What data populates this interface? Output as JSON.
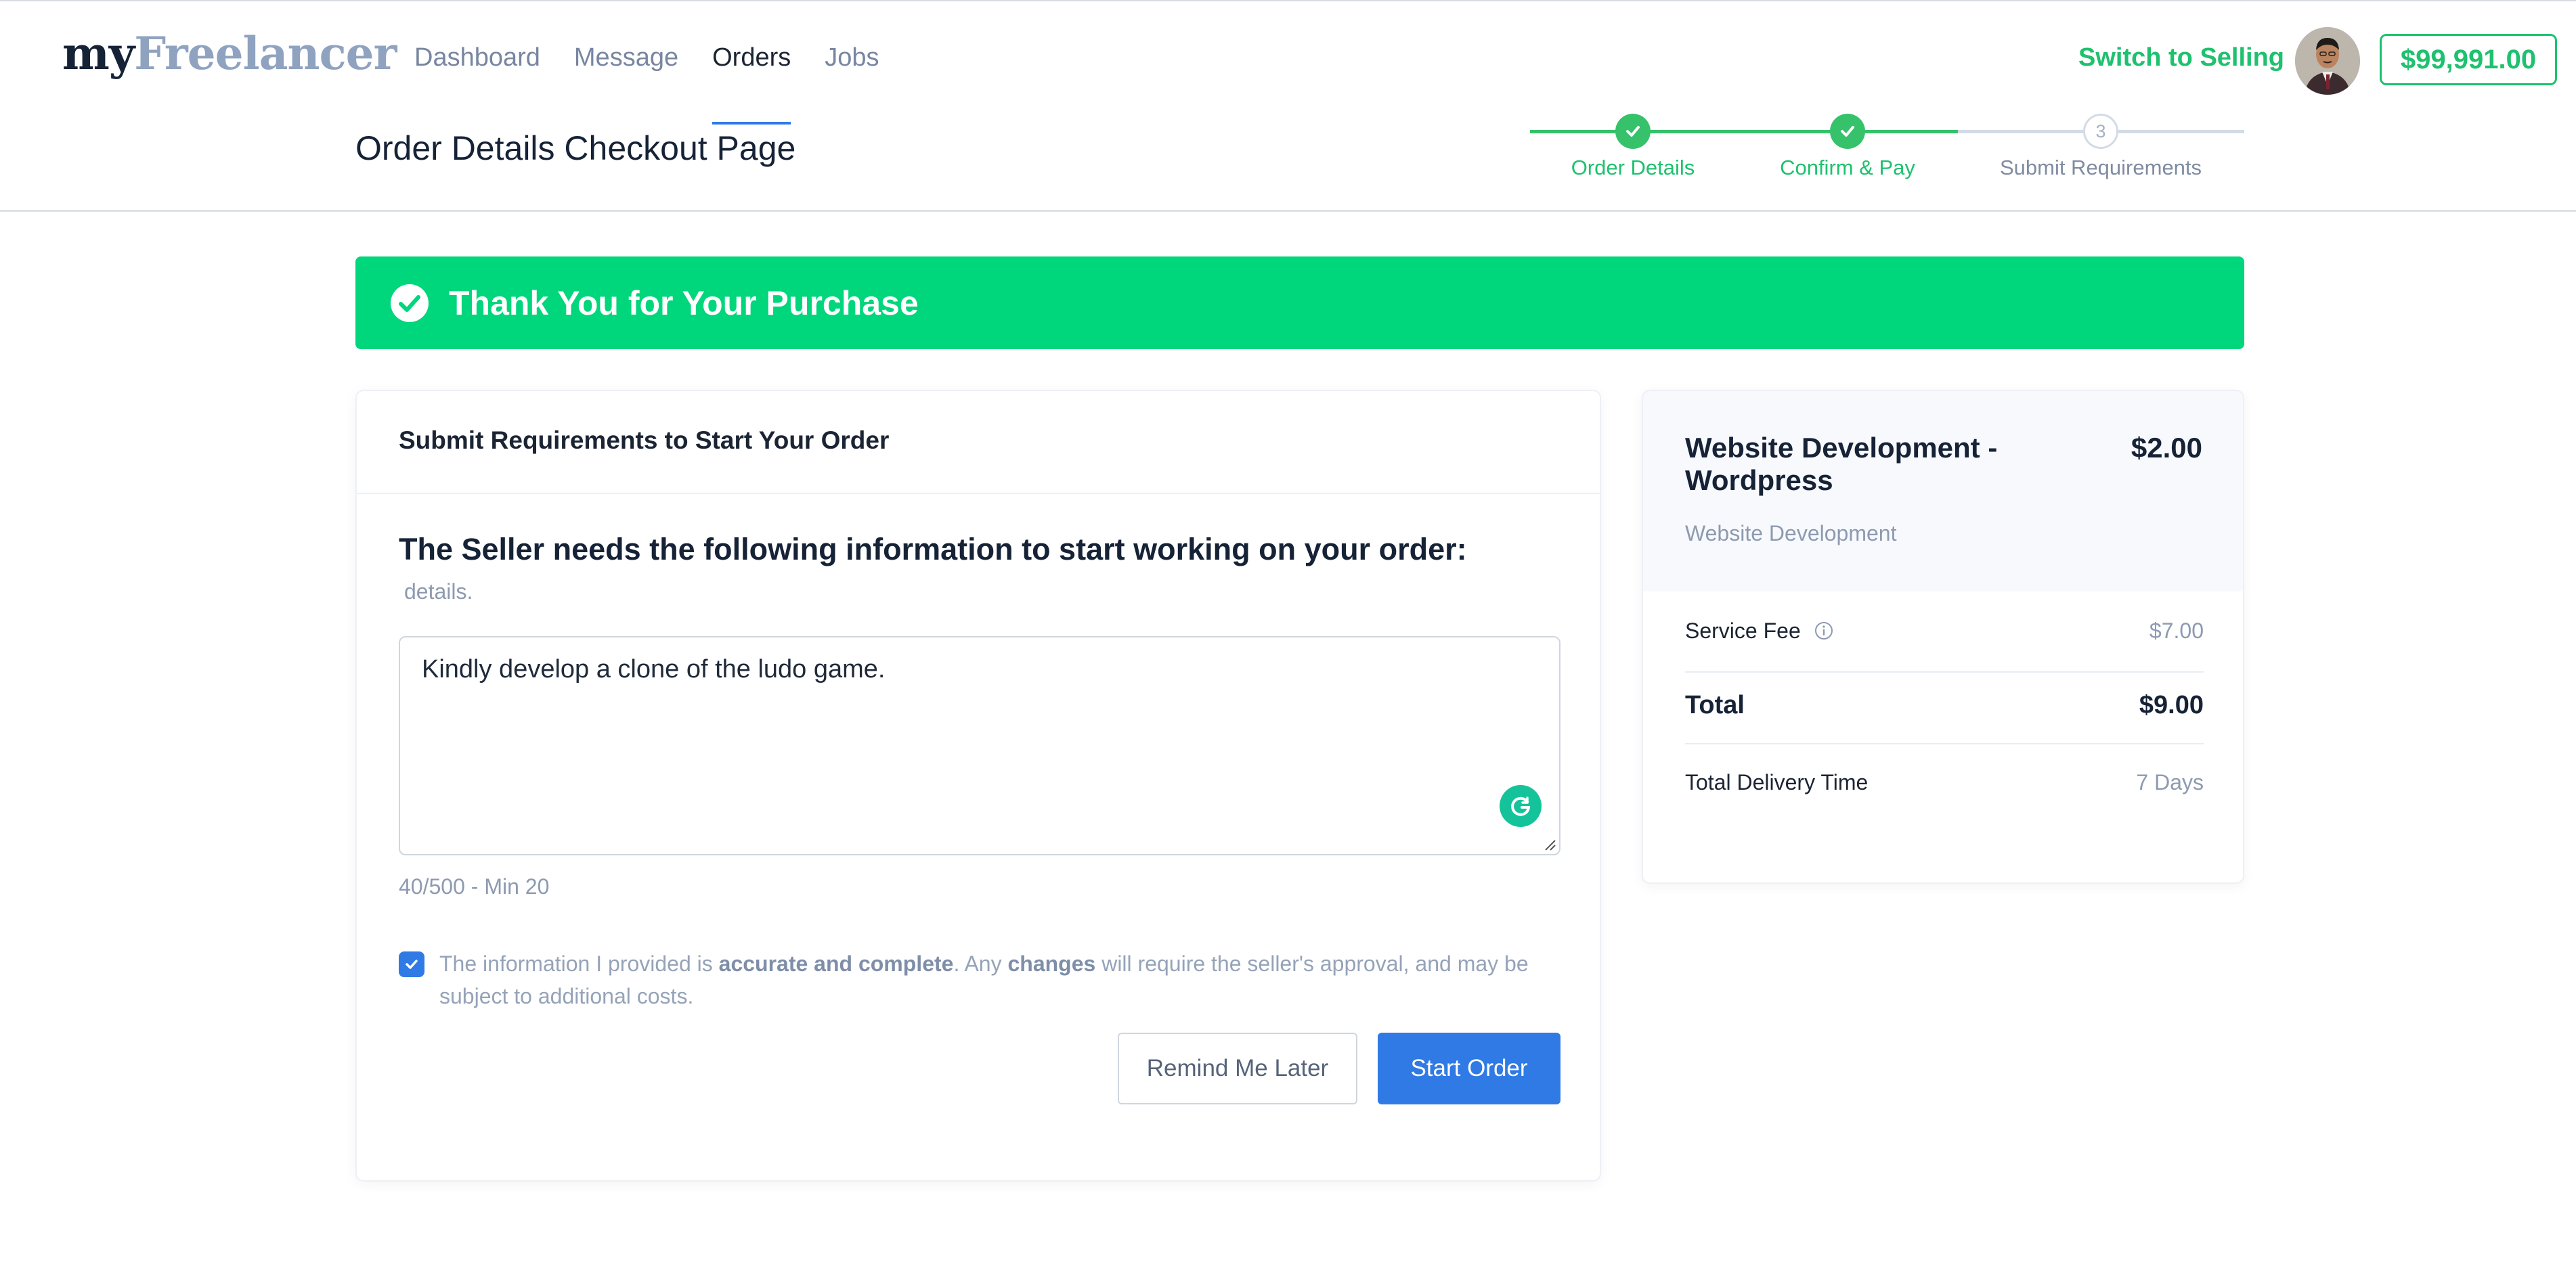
{
  "header": {
    "logo_my": "my",
    "logo_freelancer": "Freelancer",
    "nav": [
      {
        "label": "Dashboard",
        "active": false
      },
      {
        "label": "Message",
        "active": false
      },
      {
        "label": "Orders",
        "active": true
      },
      {
        "label": "Jobs",
        "active": false
      }
    ],
    "switch_label": "Switch to Selling",
    "balance": "$99,991.00"
  },
  "subheader": {
    "title": "Order Details Checkout Page",
    "steps": [
      {
        "label": "Order Details",
        "state": "done"
      },
      {
        "label": "Confirm & Pay",
        "state": "done"
      },
      {
        "label": "Submit Requirements",
        "state": "current",
        "number": "3"
      }
    ]
  },
  "banner": {
    "text": "Thank You for Your Purchase"
  },
  "requirements": {
    "heading": "Submit Requirements to Start Your Order",
    "question": "The Seller needs the following information to start working on your order:",
    "hint": "details.",
    "textarea_value": "Kindly develop a clone of the ludo game.",
    "counter": "40/500 - Min 20",
    "agreement": {
      "part1": "The information I provided is ",
      "bold1": "accurate and complete",
      "part2": ". Any ",
      "bold2": "changes",
      "part3": " will require the seller's approval, and may be subject to additional costs.",
      "checked": true
    },
    "remind_button": "Remind Me Later",
    "start_button": "Start Order"
  },
  "summary": {
    "title": "Website Development - Wordpress",
    "price": "$2.00",
    "category": "Website Development",
    "service_fee_label": "Service Fee",
    "service_fee_value": "$7.00",
    "total_label": "Total",
    "total_value": "$9.00",
    "delivery_label": "Total Delivery Time",
    "delivery_value": "7 Days"
  },
  "colors": {
    "accent_green": "#1ec16e",
    "banner_green": "#00d67b",
    "primary_blue": "#2f7ae5",
    "grammarly_green": "#15c39a"
  }
}
